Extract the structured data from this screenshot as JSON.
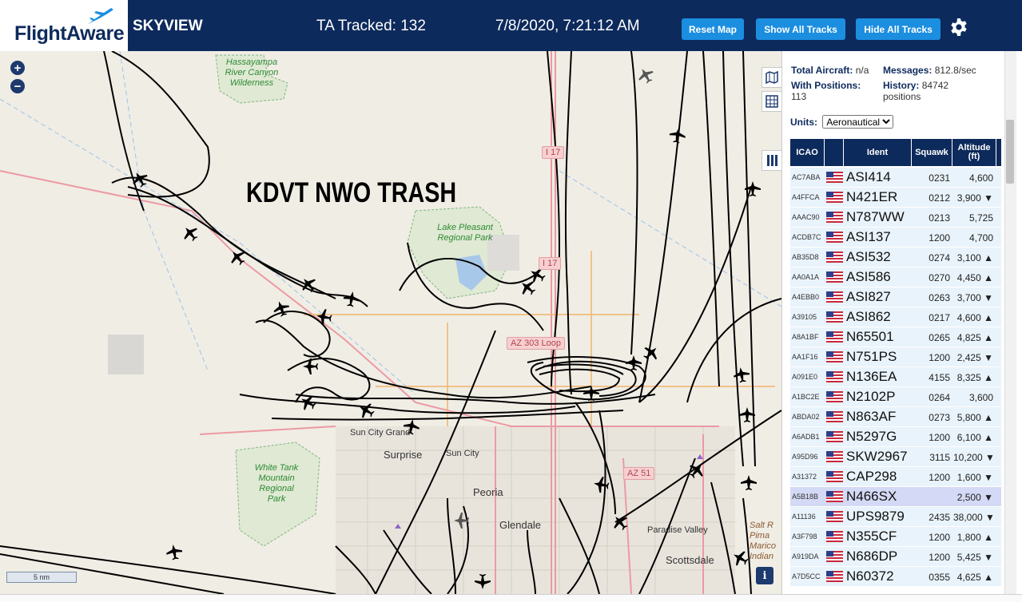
{
  "header": {
    "logo": "FlightAware",
    "app_title": "SKYVIEW",
    "tracked": "TA Tracked: 132",
    "clock": "7/8/2020, 7:21:12 AM",
    "buttons": {
      "reset": "Reset Map",
      "show_all": "Show All Tracks",
      "hide_all": "Hide All Tracks"
    },
    "settings_icon": "gear-icon"
  },
  "map": {
    "zoom_in": "+",
    "zoom_out": "−",
    "overlay_text": "KDVT NWO TRASH",
    "scale": "5 nm",
    "info": "i",
    "labels": {
      "hassayampa": "Hassayampa River Canyon Wilderness",
      "lake_pleasant": "Lake Pleasant Regional Park",
      "white_tank": "White Tank Mountain Regional Park",
      "salt_river": "Salt R Pima Marico Indian",
      "sun_city_grand": "Sun City Grand",
      "surprise": "Surprise",
      "sun_city": "Sun City",
      "peoria": "Peoria",
      "glendale": "Glendale",
      "paradise_valley": "Paradise Valley",
      "scottsdale": "Scottsdale"
    },
    "shields": {
      "i17a": "I 17",
      "i17b": "I 17",
      "az303": "AZ 303 Loop",
      "az51": "AZ 51"
    },
    "controls": [
      "map-icon",
      "grid-icon",
      "columns-icon"
    ]
  },
  "panel": {
    "stats": {
      "total_label": "Total Aircraft:",
      "total_value": "n/a",
      "messages_label": "Messages:",
      "messages_value": "812.8/sec",
      "positions_label": "With Positions:",
      "positions_value": "113",
      "history_label": "History:",
      "history_value": "84742 positions"
    },
    "units_label": "Units:",
    "units_value": "Aeronautical",
    "columns": [
      "ICAO",
      "",
      "Ident",
      "Squawk",
      "Altitude (ft)"
    ],
    "rows": [
      {
        "icao": "AC7ABA",
        "ident": "ASI414",
        "squawk": "0231",
        "alt": "4,600"
      },
      {
        "icao": "A4FFCA",
        "ident": "N421ER",
        "squawk": "0212",
        "alt": "3,900 ▼"
      },
      {
        "icao": "AAAC90",
        "ident": "N787WW",
        "squawk": "0213",
        "alt": "5,725"
      },
      {
        "icao": "ACDB7C",
        "ident": "ASI137",
        "squawk": "1200",
        "alt": "4,700"
      },
      {
        "icao": "AB35D8",
        "ident": "ASI532",
        "squawk": "0274",
        "alt": "3,100 ▲"
      },
      {
        "icao": "AA0A1A",
        "ident": "ASI586",
        "squawk": "0270",
        "alt": "4,450 ▲"
      },
      {
        "icao": "A4EBB0",
        "ident": "ASI827",
        "squawk": "0263",
        "alt": "3,700 ▼"
      },
      {
        "icao": "A39105",
        "ident": "ASI862",
        "squawk": "0217",
        "alt": "4,600 ▲"
      },
      {
        "icao": "A8A1BF",
        "ident": "N65501",
        "squawk": "0265",
        "alt": "4,825 ▲"
      },
      {
        "icao": "AA1F16",
        "ident": "N751PS",
        "squawk": "1200",
        "alt": "2,425 ▼"
      },
      {
        "icao": "A091E0",
        "ident": "N136EA",
        "squawk": "4155",
        "alt": "8,325 ▲"
      },
      {
        "icao": "A1BC2E",
        "ident": "N2102P",
        "squawk": "0264",
        "alt": "3,600"
      },
      {
        "icao": "ABDA02",
        "ident": "N863AF",
        "squawk": "0273",
        "alt": "5,800 ▲"
      },
      {
        "icao": "A6ADB1",
        "ident": "N5297G",
        "squawk": "1200",
        "alt": "6,100 ▲"
      },
      {
        "icao": "A95D96",
        "ident": "SKW2967",
        "squawk": "3115",
        "alt": "10,200 ▼"
      },
      {
        "icao": "A31372",
        "ident": "CAP298",
        "squawk": "1200",
        "alt": "1,600 ▼"
      },
      {
        "icao": "A5B18B",
        "ident": "N466SX",
        "squawk": "",
        "alt": "2,500 ▼"
      },
      {
        "icao": "A11136",
        "ident": "UPS9879",
        "squawk": "2435",
        "alt": "38,000 ▼"
      },
      {
        "icao": "A3F798",
        "ident": "N355CF",
        "squawk": "1200",
        "alt": "1,800 ▲"
      },
      {
        "icao": "A919DA",
        "ident": "N686DP",
        "squawk": "1200",
        "alt": "5,425 ▼"
      },
      {
        "icao": "A7D5CC",
        "ident": "N60372",
        "squawk": "0355",
        "alt": "4,625 ▲"
      }
    ],
    "selected_row": 16
  }
}
